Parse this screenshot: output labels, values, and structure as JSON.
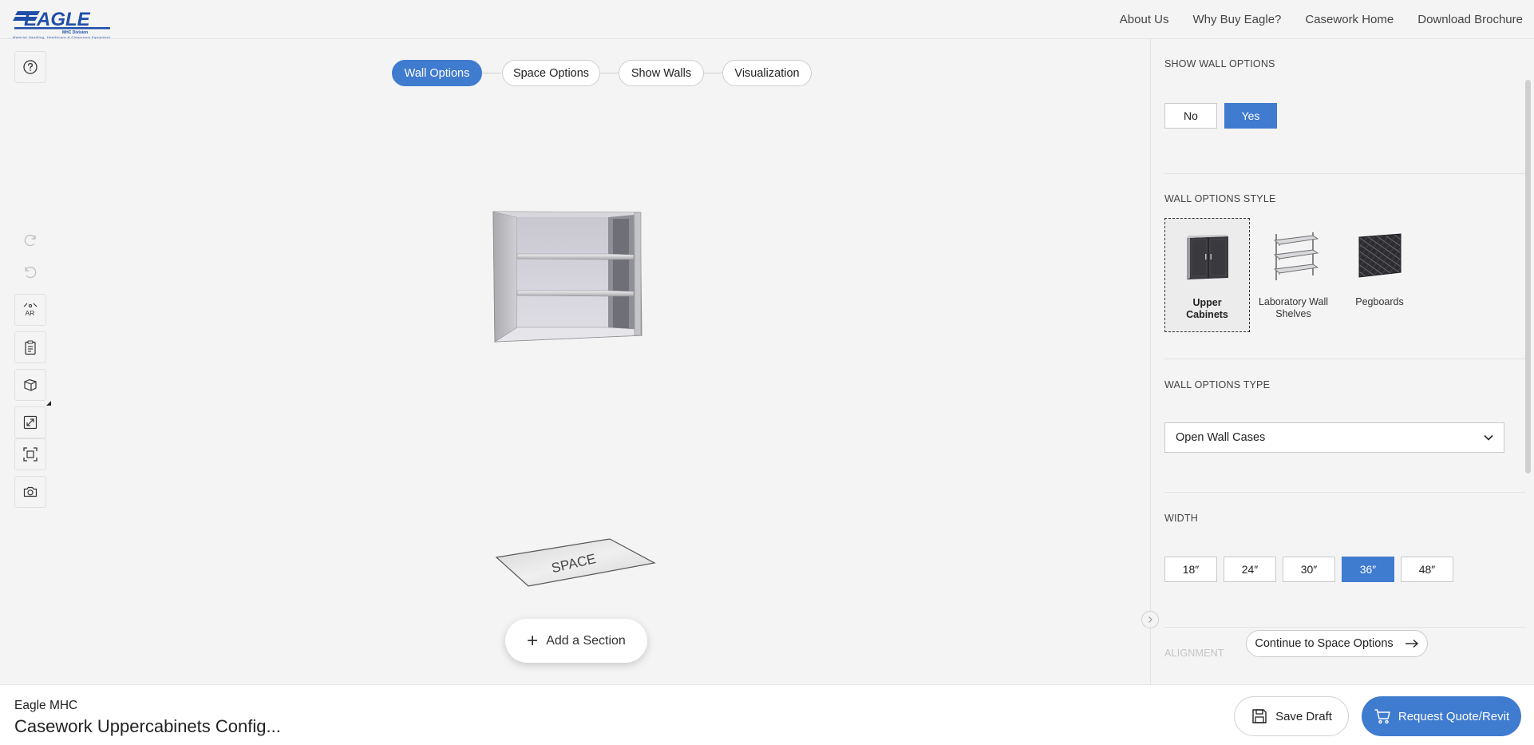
{
  "brand": {
    "logo_text": "EAGLE",
    "logo_subtext": "MHC Division",
    "logo_tagline": "Material Handling, Healthcare & Cleanroom Equipment"
  },
  "nav": {
    "items": [
      "About Us",
      "Why Buy Eagle?",
      "Casework Home",
      "Download Brochure"
    ]
  },
  "toolbar": {
    "help_icon": "question-circle-icon",
    "redo_icon": "redo-icon",
    "undo_icon": "undo-icon",
    "ar_icon": "ar-icon",
    "ar_label": "AR",
    "summary_icon": "clipboard-icon",
    "view_icon": "3d-view-icon",
    "fullscreen_icon": "expand-icon",
    "fit_icon": "fit-view-icon",
    "camera_icon": "camera-icon"
  },
  "steps": {
    "items": [
      "Wall Options",
      "Space Options",
      "Show Walls",
      "Visualization"
    ],
    "active_index": 0
  },
  "scene": {
    "space_label": "SPACE",
    "add_section_label": "Add a Section"
  },
  "panel": {
    "show_wall": {
      "title": "SHOW WALL OPTIONS",
      "options": [
        "No",
        "Yes"
      ],
      "selected": "Yes"
    },
    "style": {
      "title": "WALL OPTIONS STYLE",
      "options": [
        {
          "label": "Upper Cabinets",
          "icon": "upper-cabinet-thumbnail"
        },
        {
          "label": "Laboratory Wall Shelves",
          "icon": "wall-shelves-thumbnail"
        },
        {
          "label": "Pegboards",
          "icon": "pegboard-thumbnail"
        }
      ],
      "selected": "Upper Cabinets"
    },
    "type": {
      "title": "WALL OPTIONS TYPE",
      "value": "Open Wall Cases"
    },
    "width": {
      "title": "WIDTH",
      "options": [
        "18″",
        "24″",
        "30″",
        "36″",
        "48″"
      ],
      "selected": "36″"
    },
    "alignment": {
      "title": "ALIGNMENT"
    },
    "continue_label": "Continue to Space Options"
  },
  "footer": {
    "company": "Eagle MHC",
    "project_title": "Casework Uppercabinets Config...",
    "save_label": "Save Draft",
    "quote_label": "Request Quote/Revit"
  },
  "colors": {
    "accent": "#3f7bcf",
    "logo_blue": "#1f4fa8",
    "background": "#f4f4f4"
  }
}
